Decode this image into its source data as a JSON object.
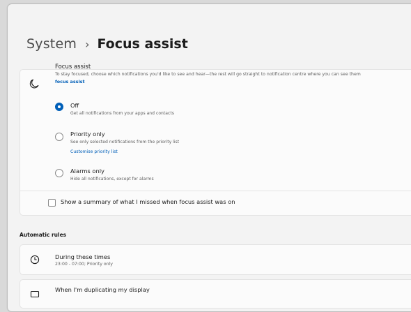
{
  "breadcrumb": {
    "parent": "System",
    "separator": "›",
    "current": "Focus assist"
  },
  "focus_assist": {
    "title": "Focus assist",
    "description": "To stay focused, choose which notifications you'd like to see and hear—the rest will go straight to notification centre where you can see them",
    "link": "focus assist",
    "icon": "moon-icon"
  },
  "options": [
    {
      "label": "Off",
      "description": "Get all notifications from your apps and contacts",
      "selected": true
    },
    {
      "label": "Priority only",
      "description": "See only selected notifications from the priority list",
      "link": "Customise priority list",
      "selected": false
    },
    {
      "label": "Alarms only",
      "description": "Hide all notifications, except for alarms",
      "selected": false
    }
  ],
  "summary_checkbox": {
    "label": "Show a summary of what I missed when focus assist was on",
    "checked": false
  },
  "automatic_rules": {
    "heading": "Automatic rules",
    "rules": [
      {
        "title": "During these times",
        "subtitle": "23:00 - 07:00; Priority only",
        "icon": "clock-icon"
      },
      {
        "title": "When I'm duplicating my display",
        "icon": "display-icon"
      }
    ]
  },
  "colors": {
    "accent": "#005fb8",
    "page_bg": "#f3f3f3",
    "card_bg": "#fbfbfb"
  }
}
